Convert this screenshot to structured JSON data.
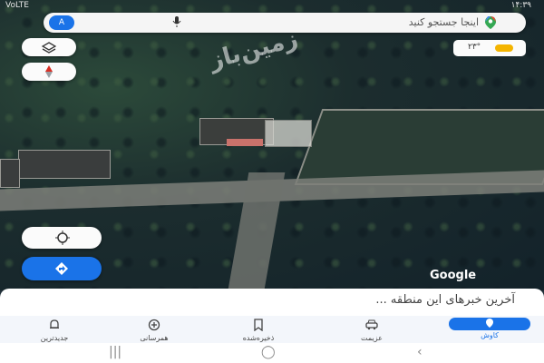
{
  "status_bar": {
    "time": "۱۴:۳۹",
    "left_text": "VoLTE"
  },
  "search": {
    "placeholder": "اینجا جستجو کنید",
    "avatar_letter": "A"
  },
  "weather": {
    "temperature": "۲۳°"
  },
  "watermark": "زمین‌باز",
  "map_attribution": "Google",
  "bottom_sheet": {
    "title": "آخرین خبرهای این منطقه ..."
  },
  "bottom_nav": {
    "items": [
      {
        "label": "جدیدترین",
        "icon": "bell-icon"
      },
      {
        "label": "همرسانی",
        "icon": "plus-circle-icon"
      },
      {
        "label": "ذخیره‌شده",
        "icon": "bookmark-icon"
      },
      {
        "label": "عزیمت",
        "icon": "car-icon"
      },
      {
        "label": "کاوش",
        "icon": "location-pin-icon",
        "active": true
      }
    ]
  },
  "colors": {
    "accent": "#1a73e8",
    "sheet": "#ffffff",
    "nav_bg": "#f3f6fb"
  }
}
